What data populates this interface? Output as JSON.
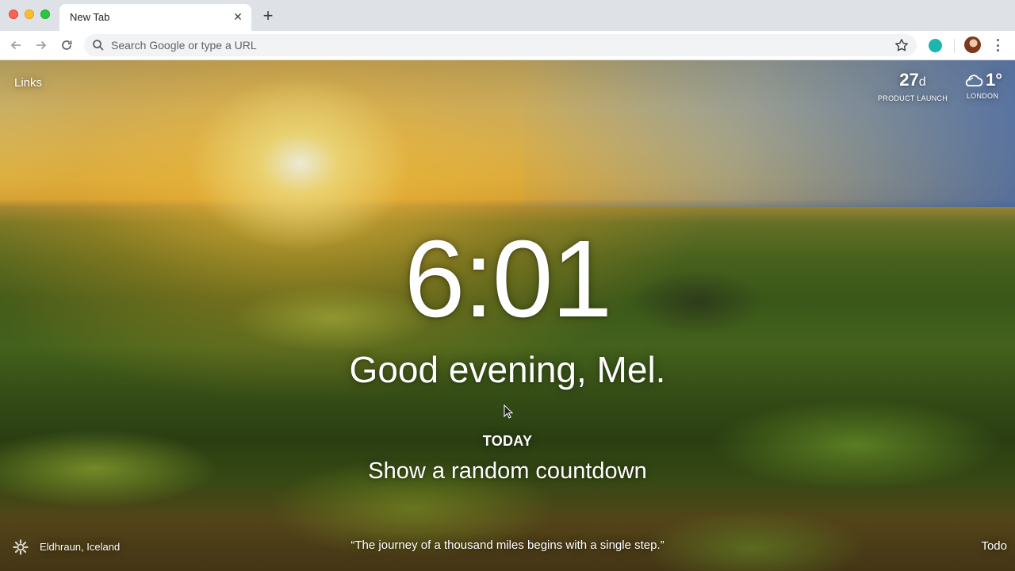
{
  "browser": {
    "tab": {
      "title": "New Tab",
      "close_glyph": "✕"
    },
    "new_tab_glyph": "+",
    "omnibox": {
      "placeholder": "Search Google or type a URL",
      "value": ""
    },
    "icons": [
      "back-arrow-icon",
      "forward-arrow-icon",
      "reload-icon",
      "search-icon",
      "star-icon",
      "extension-icon",
      "profile-avatar",
      "more-menu-icon"
    ]
  },
  "dashboard": {
    "links_label": "Links",
    "countdown": {
      "value": "27",
      "unit": "d",
      "label": "PRODUCT LAUNCH"
    },
    "weather": {
      "temp": "1°",
      "city": "LONDON",
      "icon": "cloud-icon"
    },
    "clock": "6:01",
    "greeting": "Good evening, Mel.",
    "focus": {
      "label": "TODAY",
      "text": "Show a random countdown"
    },
    "footer": {
      "photo_location": "Eldhraun, Iceland",
      "quote": "“The journey of a thousand miles begins with a single step.”",
      "todo_label": "Todo"
    }
  },
  "colors": {
    "chrome_bg": "#dee1e6",
    "extension_accent": "#1bb6ad",
    "text_on_photo": "#ffffff"
  }
}
